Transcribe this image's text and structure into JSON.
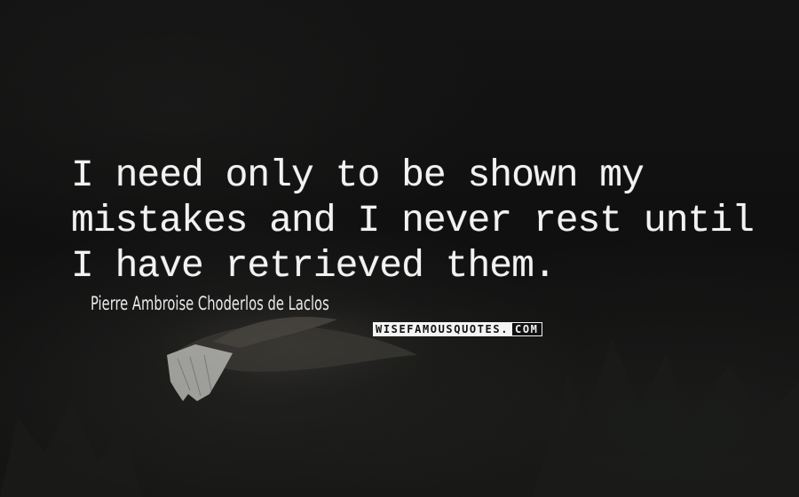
{
  "quote": {
    "lines": [
      "I need only to be shown my",
      "mistakes and I never rest until",
      "I have retrieved them."
    ]
  },
  "author": "Pierre Ambroise Choderlos de Laclos",
  "watermark": {
    "main": "WISEFAMOUSQUOTES.",
    "suffix": "COM"
  },
  "colors": {
    "background": "#111111",
    "text": "#f2f2f2"
  }
}
